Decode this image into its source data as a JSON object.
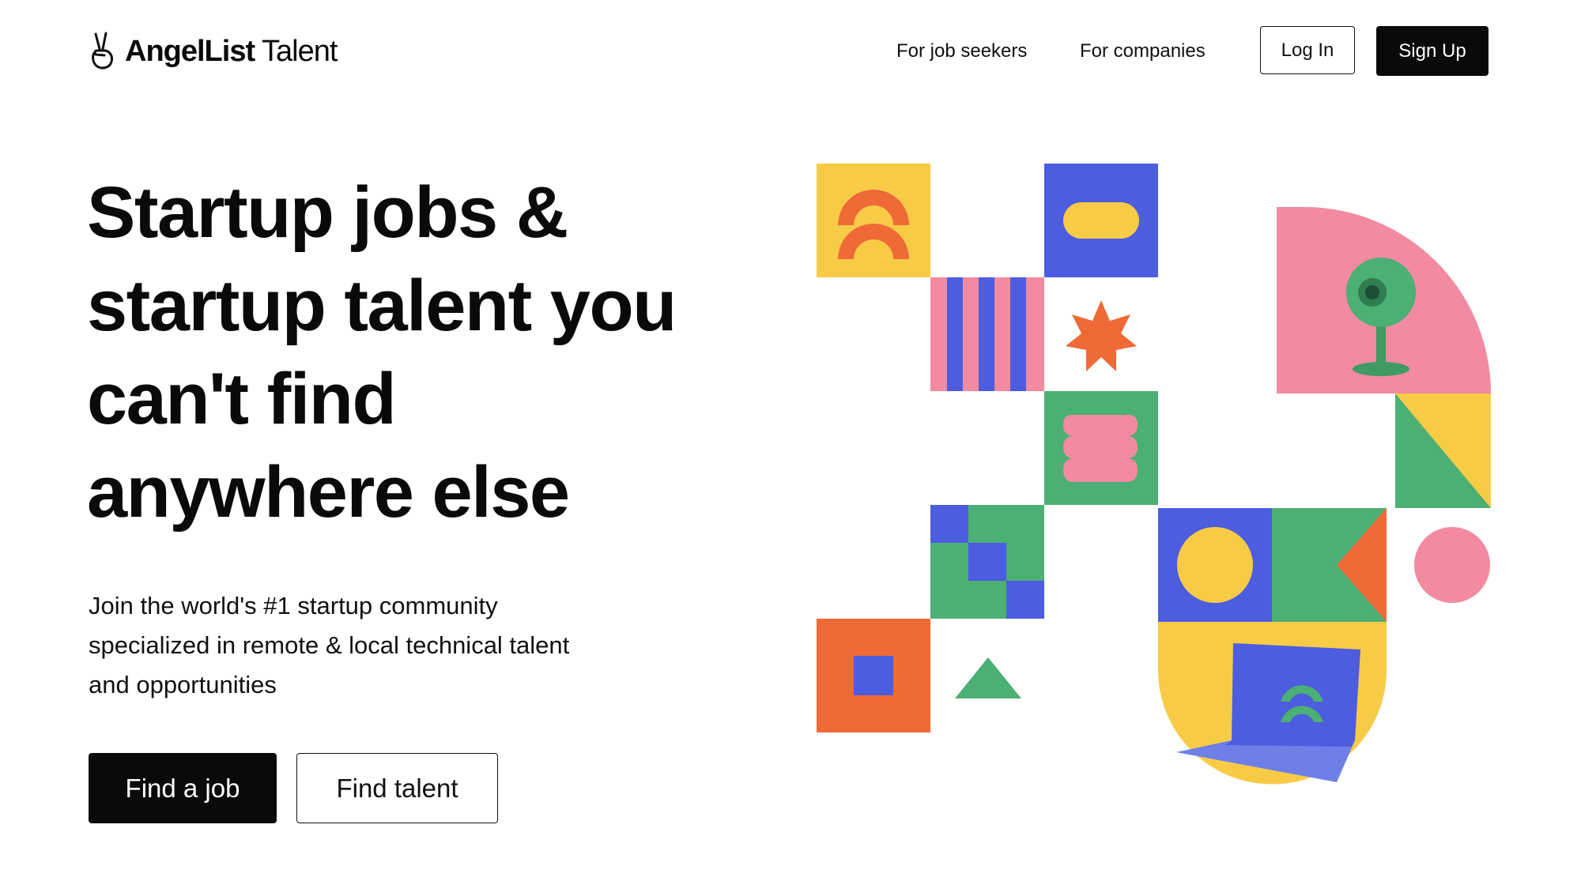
{
  "header": {
    "logo": {
      "brand_bold": "AngelList",
      "brand_light": " Talent",
      "icon": "peace-hand-icon"
    },
    "nav": [
      {
        "label": "For job seekers"
      },
      {
        "label": "For companies"
      }
    ],
    "login_label": "Log In",
    "signup_label": "Sign Up"
  },
  "hero": {
    "headline_lines": [
      "Startup jobs &",
      "startup talent you",
      "can't find",
      "anywhere else"
    ],
    "subtitle_lines": [
      "Join the world's #1 startup community",
      "specialized in remote & local technical talent",
      "and opportunities"
    ],
    "primary_cta": "Find a job",
    "secondary_cta": "Find talent"
  },
  "illustration": {
    "icons": [
      "arches-tile-icon",
      "pill-tile-icon",
      "stripes-tile-icon",
      "asterisk-star-icon",
      "wavy-pink-tile-icon",
      "checker-tile-icon",
      "circle-tile-icon",
      "triangle-arrow-tile-icon",
      "pink-circle-icon",
      "orange-square-tile-icon",
      "green-triangle-icon",
      "webcam-icon",
      "laptop-icon",
      "diagonal-split-tile-icon"
    ],
    "colors": {
      "yellow": "#f8cb47",
      "blue": "#4c5de0",
      "pink": "#f28aa0",
      "orange": "#ef6a37",
      "green": "#4caf74"
    }
  }
}
